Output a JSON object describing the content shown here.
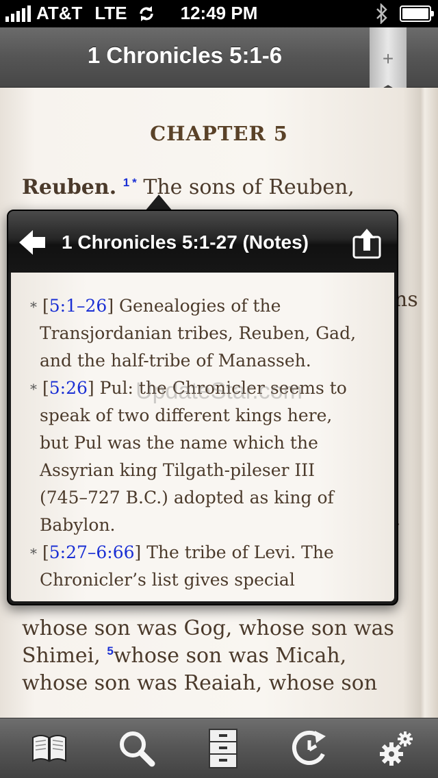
{
  "status_bar": {
    "carrier": "AT&T",
    "network": "LTE",
    "time": "12:49 PM"
  },
  "nav": {
    "title": "1 Chronicles 5:1-6",
    "bookmark_symbol": "+"
  },
  "reading": {
    "chapter_heading": "CHAPTER 5",
    "section_heading": "Reuben.",
    "verse1_num": "1",
    "note_marker": "*",
    "line1_text": " The sons of Reuben,",
    "right_edge_fragment_1": "ns",
    "right_edge_fragment_2": ".",
    "line_a_text": "whose son was Gog, whose son was",
    "line_b_start": "Shimei,",
    "verse5_num": "5",
    "line_b_rest": "whose son was Micah,",
    "line_c_text": "whose son was Reaiah, whose son"
  },
  "notes_popover": {
    "title": "1 Chronicles 5:1-27 (Notes)",
    "notes": [
      {
        "marker": "*",
        "ref": "5:1–26",
        "lines": [
          " Genealogies of the",
          "Transjordanian tribes, Reuben, Gad,",
          "and the half-tribe of Manasseh."
        ]
      },
      {
        "marker": "*",
        "ref": "5:26",
        "lines": [
          " Pul: the Chronicler seems to",
          "speak of two different kings here,",
          "but Pul was the name which the",
          "Assyrian king Tilgath-pileser III",
          "(745–727 B.C.) adopted as king of",
          "Babylon."
        ]
      },
      {
        "marker": "*",
        "ref": "5:27–6:66",
        "lines": [
          " The tribe of Levi. The",
          "Chronicler’s list gives special"
        ]
      }
    ]
  },
  "watermark": "UpdateStar.com",
  "tab_bar": {
    "icons": [
      "book-icon",
      "search-icon",
      "file-cabinet-icon",
      "history-icon",
      "settings-icon"
    ]
  },
  "colors": {
    "verse_number": "#1a2fd4",
    "text": "#4b3a2b",
    "chapter_heading": "#5a4228"
  }
}
